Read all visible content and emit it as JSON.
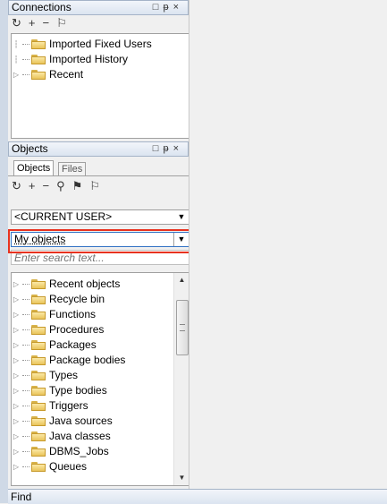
{
  "connections_panel": {
    "title": "Connections",
    "controls": [
      "□",
      "ᵽ",
      "×"
    ],
    "toolbar_icons": [
      "refresh-icon",
      "add-icon",
      "remove-icon",
      "connect-icon"
    ],
    "tree": [
      {
        "label": "Imported Fixed Users",
        "expandable": false
      },
      {
        "label": "Imported History",
        "expandable": false
      },
      {
        "label": "Recent",
        "expandable": true
      }
    ]
  },
  "objects_panel": {
    "title": "Objects",
    "controls": [
      "□",
      "ᵽ",
      "×"
    ],
    "tabs": [
      "Objects",
      "Files"
    ],
    "active_tab": "Objects",
    "toolbar_icons": [
      "refresh-icon",
      "add-icon",
      "remove-icon",
      "find-icon",
      "filter-icon",
      "connect-icon"
    ],
    "user_select": "<CURRENT USER>",
    "filter_select": "My objects",
    "search_placeholder": "Enter search text...",
    "tree": [
      "Recent objects",
      "Recycle bin",
      "Functions",
      "Procedures",
      "Packages",
      "Package bodies",
      "Types",
      "Type bodies",
      "Triggers",
      "Java sources",
      "Java classes",
      "DBMS_Jobs",
      "Queues"
    ]
  },
  "find_bar": {
    "label": "Find"
  },
  "colors": {
    "highlight_box": "#e8321f",
    "titlebar_border": "#a4b3c7"
  }
}
